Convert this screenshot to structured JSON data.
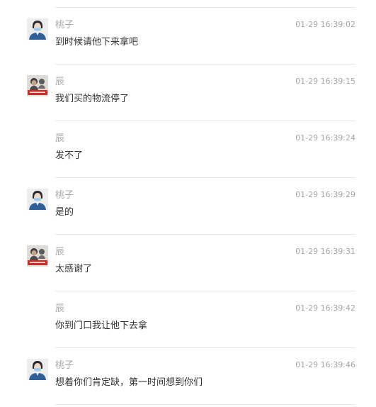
{
  "messages": [
    {
      "sender": "桃子",
      "avatar": "peach-avatar",
      "time": "01-29 16:39:02",
      "text": "到时候请他下来拿吧"
    },
    {
      "sender": "辰",
      "avatar": "chen-avatar",
      "time": "01-29 16:39:15",
      "text": "我们买的物流停了"
    },
    {
      "sender": "辰",
      "avatar": "",
      "time": "01-29 16:39:24",
      "text": "发不了"
    },
    {
      "sender": "桃子",
      "avatar": "peach-avatar",
      "time": "01-29 16:39:29",
      "text": "是的"
    },
    {
      "sender": "辰",
      "avatar": "chen-avatar",
      "time": "01-29 16:39:31",
      "text": "太感谢了"
    },
    {
      "sender": "辰",
      "avatar": "",
      "time": "01-29 16:39:42",
      "text": "你到门口我让他下去拿"
    },
    {
      "sender": "桃子",
      "avatar": "peach-avatar",
      "time": "01-29 16:39:46",
      "text": "想着你们肯定缺，第一时间想到你们"
    }
  ],
  "colors": {
    "meta_text": "#a6a6a6",
    "message_text": "#333333",
    "divider": "#e6e6e6"
  }
}
